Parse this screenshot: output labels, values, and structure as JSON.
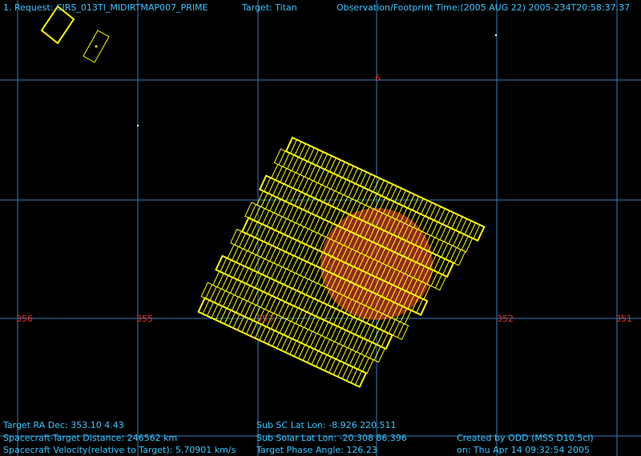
{
  "header": {
    "request": "1. Request: CIRS_013TI_MIDIRTMAP007_PRIME",
    "target": "Target: Titan",
    "time": "Observation/Footprint Time:(2005 AUG 22) 2005-234T20:58:37.37"
  },
  "ticks": {
    "dec_top": "6",
    "ra": [
      "356",
      "355",
      "353",
      "352",
      "351"
    ]
  },
  "footer": {
    "ra_dec": "Target RA  Dec: 353.10    4.43",
    "distance": "Spacecraft-Target Distance:  246562 km",
    "velocity": "Spacecraft Velocity(relative to Target): 5.70901 km/s",
    "sub_sc": "Sub SC Lat Lon: -8.926  220.511",
    "sub_solar": "Sub Solar Lat Lon: -20.308  86.396",
    "phase": "Target Phase Angle: 126.23",
    "created": "Created by ODD (MSS D10.5cl)",
    "created_on": "on: Thu Apr 14 09:32:54 2005"
  },
  "colors": {
    "text": "#35c7ff",
    "grid": "#2f7fbf",
    "tick": "#e2332e",
    "footprint": "#ffff00",
    "target": "#c0392b"
  }
}
